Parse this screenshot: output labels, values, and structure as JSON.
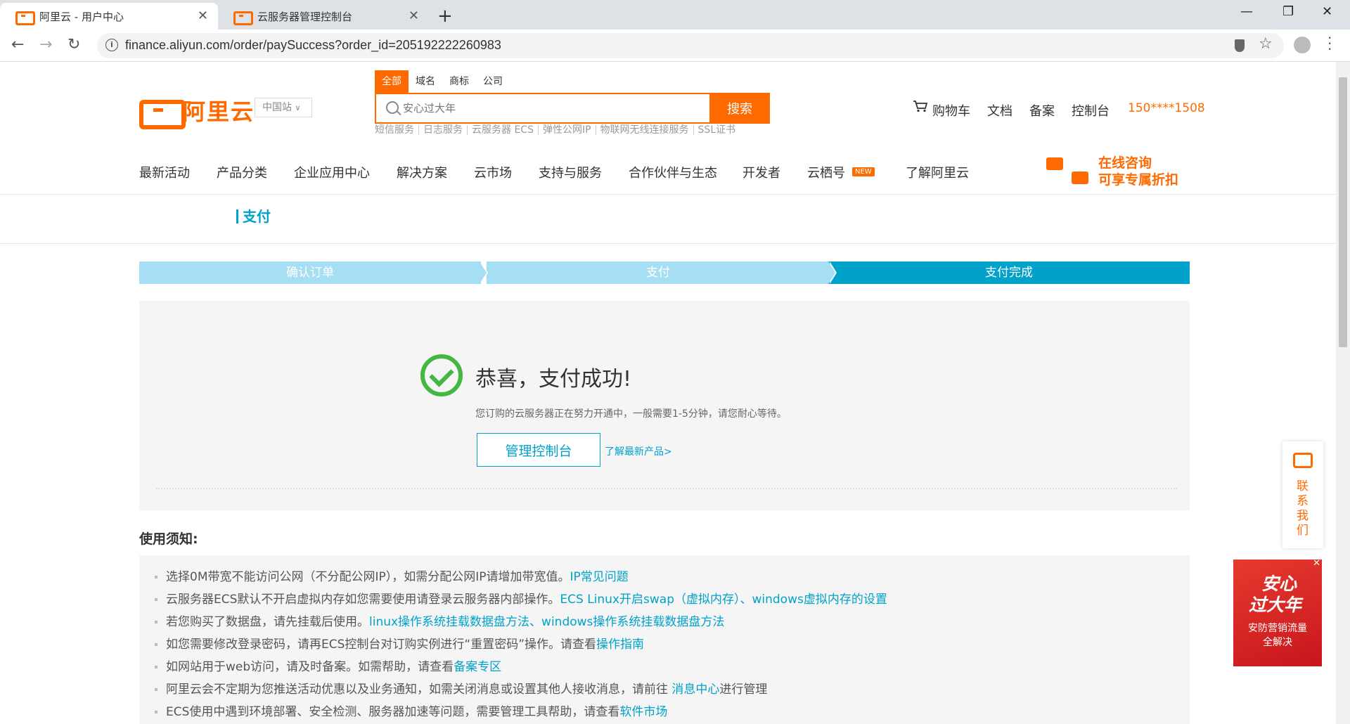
{
  "browser": {
    "tabs": [
      {
        "title": "阿里云 - 用户中心",
        "active": true
      },
      {
        "title": "云服务器管理控制台",
        "active": false
      }
    ],
    "new_tab": "+",
    "url": "finance.aliyun.com/order/paySuccess?order_id=205192222260983",
    "window_controls": {
      "minimize": "—",
      "maximize": "❐",
      "close": "✕"
    }
  },
  "header": {
    "logo_text": "阿里云",
    "region": "中国站",
    "search_tabs": [
      "全部",
      "域名",
      "商标",
      "公司"
    ],
    "search_placeholder": "安心过大年",
    "search_button": "搜索",
    "hotwords": [
      "短信服务",
      "日志服务",
      "云服务器 ECS",
      "弹性公网IP",
      "物联网无线连接服务",
      "SSL证书"
    ],
    "links": {
      "cart": "购物车",
      "docs": "文档",
      "beian": "备案",
      "console": "控制台"
    },
    "phone": "150****1508"
  },
  "nav": {
    "items": [
      "最新活动",
      "产品分类",
      "企业应用中心",
      "解决方案",
      "云市场",
      "支持与服务",
      "合作伙伴与生态",
      "开发者",
      "云栖号",
      "了解阿里云"
    ],
    "new_badge": "NEW",
    "consult_line1": "在线咨询",
    "consult_line2": "可享专属折扣"
  },
  "page": {
    "title": "支付",
    "steps": [
      "确认订单",
      "支付",
      "支付完成"
    ],
    "current_step": 3
  },
  "result": {
    "title": "恭喜，支付成功!",
    "desc": "您订购的云服务器正在努力开通中，一般需要1-5分钟，请您耐心等待。",
    "manage_button": "管理控制台",
    "learn_link": "了解最新产品>"
  },
  "notice": {
    "title": "使用须知:",
    "items": [
      {
        "text": "选择0M带宽不能访问公网（不分配公网IP），如需分配公网IP请增加带宽值。",
        "link": "IP常见问题",
        "text2": "",
        "link2": "",
        "text3": ""
      },
      {
        "text": "云服务器ECS默认不开启虚拟内存如您需要使用请登录云服务器内部操作。",
        "link": "ECS Linux开启swap（虚拟内存）、windows虚拟内存的设置",
        "text2": "",
        "link2": "",
        "text3": ""
      },
      {
        "text": "若您购买了数据盘，请先挂载后使用。",
        "link": "linux操作系统挂载数据盘方法、windows操作系统挂载数据盘方法",
        "text2": "",
        "link2": "",
        "text3": ""
      },
      {
        "text": "如您需要修改登录密码，请再ECS控制台对订购实例进行“重置密码”操作。请查看",
        "link": "操作指南",
        "text2": "",
        "link2": "",
        "text3": ""
      },
      {
        "text": "如网站用于web访问，请及时备案。如需帮助，请查看",
        "link": "备案专区",
        "text2": "",
        "link2": "",
        "text3": ""
      },
      {
        "text": "阿里云会不定期为您推送活动优惠以及业务通知，如需关闭消息或设置其他人接收消息，请前往 ",
        "link": "消息中心",
        "text2": "进行管理",
        "link2": "",
        "text3": ""
      },
      {
        "text": "ECS使用中遇到环境部署、安全检测、服务器加速等问题，需要管理工具帮助，请查看",
        "link": "软件市场",
        "text2": "",
        "link2": "",
        "text3": ""
      }
    ]
  },
  "widgets": {
    "contact": "联系我们",
    "promo_line1": "安心",
    "promo_line2": "过大年",
    "promo_line3": "安防营销流量",
    "promo_line4": "全解决",
    "promo_close": "✕"
  },
  "colors": {
    "brand": "#ff6a00",
    "accent": "#00a2ca",
    "success": "#42b843",
    "step_inactive": "#a6dff3"
  }
}
